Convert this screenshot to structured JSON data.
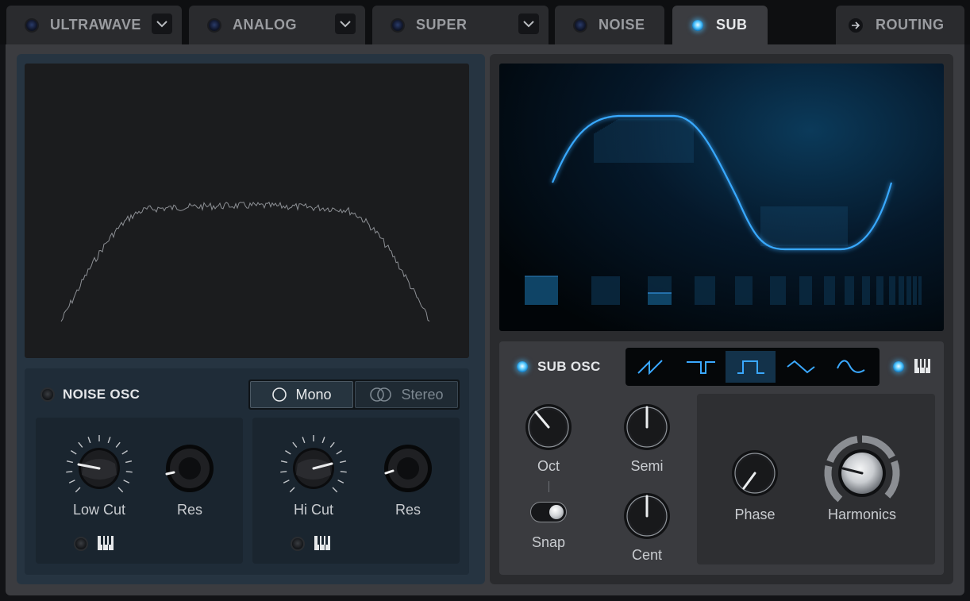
{
  "tabs": [
    {
      "label": "ULTRAWAVE",
      "active": false,
      "has_dropdown": true
    },
    {
      "label": "ANALOG",
      "active": false,
      "has_dropdown": true
    },
    {
      "label": "SUPER",
      "active": false,
      "has_dropdown": true
    },
    {
      "label": "NOISE",
      "active": false,
      "has_dropdown": false
    },
    {
      "label": "SUB",
      "active": true,
      "has_dropdown": false
    },
    {
      "label": "ROUTING",
      "active": false,
      "has_dropdown": false
    }
  ],
  "noise": {
    "title": "NOISE OSC",
    "enabled": false,
    "mode_options": {
      "mono": "Mono",
      "stereo": "Stereo"
    },
    "mode_selected": "Mono",
    "low_cut": {
      "label": "Low Cut",
      "res_label": "Res",
      "keytrack": false
    },
    "hi_cut": {
      "label": "Hi Cut",
      "res_label": "Res",
      "keytrack": false
    }
  },
  "sub": {
    "title": "SUB OSC",
    "enabled": true,
    "waveforms": [
      "saw-icon",
      "pulse-icon",
      "square-icon",
      "triangle-icon",
      "sine-icon"
    ],
    "selected_waveform": "square-icon",
    "keytrack": true,
    "knobs": {
      "oct": "Oct",
      "semi": "Semi",
      "cent": "Cent",
      "phase": "Phase",
      "harmonics": "Harmonics"
    },
    "snap_label": "Snap",
    "snap_on": true
  },
  "colors": {
    "accent": "#3aa8ff",
    "led_on": "#55caff",
    "panel_blue": "#263441"
  }
}
